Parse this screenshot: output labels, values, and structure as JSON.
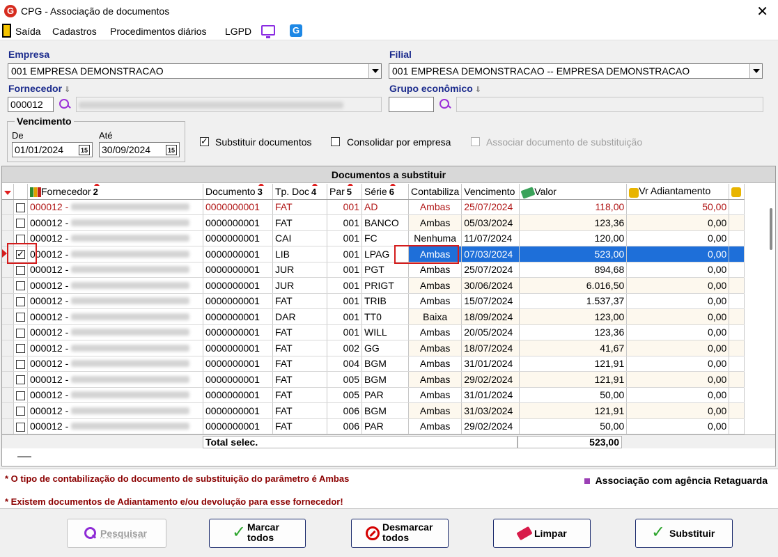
{
  "window": {
    "title": "CPG - Associação de documentos",
    "logo_letter": "G",
    "close_glyph": "✕"
  },
  "menu": {
    "items": [
      "Saída",
      "Cadastros",
      "Procedimentos diários",
      "LGPD"
    ],
    "g_letter": "G"
  },
  "form": {
    "empresa_label": "Empresa",
    "empresa_value": "001 EMPRESA DEMONSTRACAO",
    "filial_label": "Filial",
    "filial_value": "001 EMPRESA DEMONSTRACAO -- EMPRESA DEMONSTRACAO",
    "fornecedor_label": "Fornecedor",
    "fornecedor_code": "000012",
    "grupo_label": "Grupo econômico",
    "grupo_value": "",
    "vencimento_label": "Vencimento",
    "de_label": "De",
    "de_value": "01/01/2024",
    "ate_label": "Até",
    "ate_value": "30/09/2024",
    "cal_glyph": "15",
    "arrow_down": "⇓",
    "opt_substituir": "Substituir documentos",
    "opt_consolidar": "Consolidar por empresa",
    "opt_associar": "Associar documento de substituição"
  },
  "grid": {
    "title": "Documentos a substituir",
    "headers": {
      "fornecedor": "Fornecedor",
      "fornecedor_n": "2",
      "documento": "Documento",
      "documento_n": "3",
      "tpdoc": "Tp. Doc",
      "tpdoc_n": "4",
      "par": "Par",
      "par_n": "5",
      "serie": "Série",
      "serie_n": "6",
      "contabiliza": "Contabiliza",
      "vencimento": "Vencimento",
      "valor": "Valor",
      "vradiant": "Vr Adiantamento"
    },
    "rows": [
      {
        "checked": false,
        "forn": "000012 -",
        "doc": "0000000001",
        "tp": "FAT",
        "par": "001",
        "serie": "AD",
        "cont": "Ambas",
        "venc": "25/07/2024",
        "valor": "118,00",
        "adiant": "50,00",
        "red": true
      },
      {
        "checked": false,
        "forn": "000012 -",
        "doc": "0000000001",
        "tp": "FAT",
        "par": "001",
        "serie": "BANCO",
        "cont": "Ambas",
        "venc": "05/03/2024",
        "valor": "123,36",
        "adiant": "0,00",
        "red": false
      },
      {
        "checked": false,
        "forn": "000012 -",
        "doc": "0000000001",
        "tp": "CAI",
        "par": "001",
        "serie": "FC",
        "cont": "Nenhuma",
        "venc": "11/07/2024",
        "valor": "120,00",
        "adiant": "0,00",
        "red": false
      },
      {
        "checked": true,
        "forn": "000012 -",
        "doc": "0000000001",
        "tp": "LIB",
        "par": "001",
        "serie": "LPAG",
        "cont": "Ambas",
        "venc": "07/03/2024",
        "valor": "523,00",
        "adiant": "0,00",
        "red": false,
        "selected": true
      },
      {
        "checked": false,
        "forn": "000012 -",
        "doc": "0000000001",
        "tp": "JUR",
        "par": "001",
        "serie": "PGT",
        "cont": "Ambas",
        "venc": "25/07/2024",
        "valor": "894,68",
        "adiant": "0,00",
        "red": false
      },
      {
        "checked": false,
        "forn": "000012 -",
        "doc": "0000000001",
        "tp": "JUR",
        "par": "001",
        "serie": "PRIGT",
        "cont": "Ambas",
        "venc": "30/06/2024",
        "valor": "6.016,50",
        "adiant": "0,00",
        "red": false
      },
      {
        "checked": false,
        "forn": "000012 -",
        "doc": "0000000001",
        "tp": "FAT",
        "par": "001",
        "serie": "TRIB",
        "cont": "Ambas",
        "venc": "15/07/2024",
        "valor": "1.537,37",
        "adiant": "0,00",
        "red": false
      },
      {
        "checked": false,
        "forn": "000012 -",
        "doc": "0000000001",
        "tp": "DAR",
        "par": "001",
        "serie": "TT0",
        "cont": "Baixa",
        "venc": "18/09/2024",
        "valor": "123,00",
        "adiant": "0,00",
        "red": false
      },
      {
        "checked": false,
        "forn": "000012 -",
        "doc": "0000000001",
        "tp": "FAT",
        "par": "001",
        "serie": "WILL",
        "cont": "Ambas",
        "venc": "20/05/2024",
        "valor": "123,36",
        "adiant": "0,00",
        "red": false
      },
      {
        "checked": false,
        "forn": "000012 -",
        "doc": "0000000001",
        "tp": "FAT",
        "par": "002",
        "serie": "GG",
        "cont": "Ambas",
        "venc": "18/07/2024",
        "valor": "41,67",
        "adiant": "0,00",
        "red": false
      },
      {
        "checked": false,
        "forn": "000012 -",
        "doc": "0000000001",
        "tp": "FAT",
        "par": "004",
        "serie": "BGM",
        "cont": "Ambas",
        "venc": "31/01/2024",
        "valor": "121,91",
        "adiant": "0,00",
        "red": false
      },
      {
        "checked": false,
        "forn": "000012 -",
        "doc": "0000000001",
        "tp": "FAT",
        "par": "005",
        "serie": "BGM",
        "cont": "Ambas",
        "venc": "29/02/2024",
        "valor": "121,91",
        "adiant": "0,00",
        "red": false
      },
      {
        "checked": false,
        "forn": "000012 -",
        "doc": "0000000001",
        "tp": "FAT",
        "par": "005",
        "serie": "PAR",
        "cont": "Ambas",
        "venc": "31/01/2024",
        "valor": "50,00",
        "adiant": "0,00",
        "red": false
      },
      {
        "checked": false,
        "forn": "000012 -",
        "doc": "0000000001",
        "tp": "FAT",
        "par": "006",
        "serie": "BGM",
        "cont": "Ambas",
        "venc": "31/03/2024",
        "valor": "121,91",
        "adiant": "0,00",
        "red": false
      },
      {
        "checked": false,
        "forn": "000012 -",
        "doc": "0000000001",
        "tp": "FAT",
        "par": "006",
        "serie": "PAR",
        "cont": "Ambas",
        "venc": "29/02/2024",
        "valor": "50,00",
        "adiant": "0,00",
        "red": false
      }
    ],
    "total_label": "Total selec.",
    "total_value": "523,00"
  },
  "notes": {
    "line1": "* O tipo de contabilização do documento de substituição do parâmetro é Ambas",
    "line2": "* Existem documentos de Adiantamento e/ou devolução para esse fornecedor!",
    "legend": "Associação com agência Retaguarda",
    "legend_color": "#9b3fb5"
  },
  "buttons": {
    "pesquisar": "Pesquisar",
    "marcar_1": "Marcar",
    "marcar_2": "todos",
    "desmarcar_1": "Desmarcar",
    "desmarcar_2": "todos",
    "limpar": "Limpar",
    "substituir": "Substituir"
  }
}
